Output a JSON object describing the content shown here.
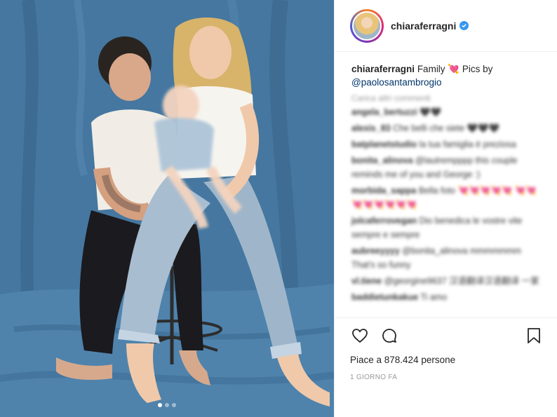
{
  "post": {
    "username": "chiaraferragni",
    "caption": {
      "author": "chiaraferragni",
      "text": "Family 💘 Pics by",
      "mention": "@paolosantambrogio"
    },
    "load_more": "Carica altri commenti",
    "comments": [
      {
        "user": "angela_bertuzzi",
        "text": "🖤🖤"
      },
      {
        "user": "alexis_83",
        "text": "Che belli che siete 🖤🖤🖤"
      },
      {
        "user": "batplanetstudio",
        "text": "la tua famiglia è preziosa"
      },
      {
        "user": "bonita_alinova",
        "text": "@lautrempppp this couple reminds me of you and George :)"
      },
      {
        "user": "morbida_sappa",
        "text": "Bella foto 💘💘💘💘💘 💘💘💘💘💘💘💘💘"
      },
      {
        "user": "jolcaferrovegan",
        "text": "Dio benedica le vostre vite sempre e sempre"
      },
      {
        "user": "aubreeyyyy",
        "text": "@bonita_alinova mmmmmmm That's so funny"
      },
      {
        "user": "vl.tiene",
        "text": "@georgine9637 汉语翻译汉语翻译 一家"
      },
      {
        "user": "baddietunkakue",
        "text": "Ti amo"
      }
    ],
    "likes_text": "Piace a 878.424 persone",
    "timestamp": "1 GIORNO FA",
    "carousel": {
      "count": 3,
      "active": 0
    }
  },
  "icons": {
    "like": "heart-icon",
    "comment": "speech-bubble-icon",
    "save": "bookmark-icon",
    "verified": "verified-badge-icon"
  },
  "colors": {
    "verified": "#3897f0",
    "mention": "#003569",
    "backdrop": "#4a7ca3"
  }
}
